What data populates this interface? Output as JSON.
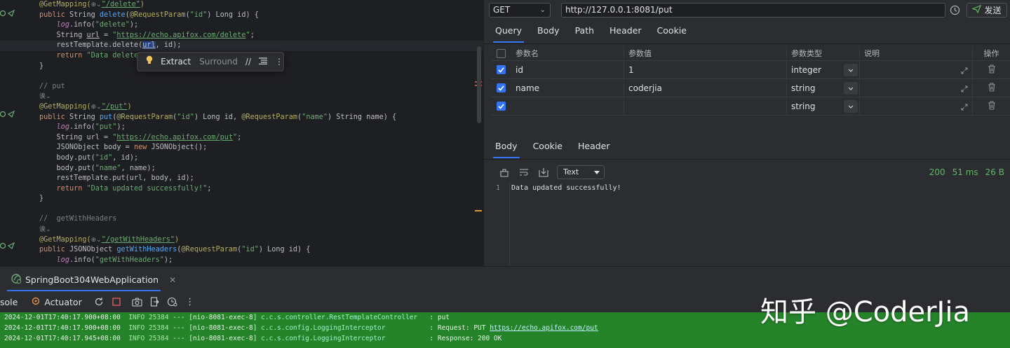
{
  "editor": {
    "code_lines": [
      {
        "segments": [
          {
            "t": "@GetMapping(",
            "c": "an"
          },
          {
            "t": "⊕⌄",
            "c": "hint"
          },
          {
            "t": "\"/delete\"",
            "c": "st ul"
          },
          {
            "t": ")",
            "c": "an"
          }
        ]
      },
      {
        "segments": [
          {
            "t": "public ",
            "c": "kw"
          },
          {
            "t": "String "
          },
          {
            "t": "delete",
            "c": "method"
          },
          {
            "t": "("
          },
          {
            "t": "@RequestParam",
            "c": "an"
          },
          {
            "t": "("
          },
          {
            "t": "\"id\"",
            "c": "st"
          },
          {
            "t": ") Long id) {"
          }
        ]
      },
      {
        "segments": [
          {
            "t": "    "
          },
          {
            "t": "log",
            "c": "lg"
          },
          {
            "t": ".info("
          },
          {
            "t": "\"delete\"",
            "c": "st"
          },
          {
            "t": ");"
          }
        ]
      },
      {
        "segments": [
          {
            "t": "    String "
          },
          {
            "t": "url",
            "c": "ul"
          },
          {
            "t": " = "
          },
          {
            "t": "\"",
            "c": "st"
          },
          {
            "t": "https://echo.apifox.com/delete",
            "c": "st ul"
          },
          {
            "t": "\"",
            "c": "st"
          },
          {
            "t": ";"
          }
        ]
      },
      {
        "current": true,
        "segments": [
          {
            "t": "    restTemplate.delete("
          },
          {
            "t": "url",
            "c": "sel ul"
          },
          {
            "t": ", id);"
          }
        ]
      },
      {
        "segments": [
          {
            "t": "    "
          },
          {
            "t": "return ",
            "c": "kw"
          },
          {
            "t": "\"Data deleted",
            "c": "st"
          }
        ]
      },
      {
        "segments": [
          {
            "t": "}"
          }
        ]
      },
      {
        "segments": [
          {
            "t": ""
          }
        ]
      },
      {
        "segments": [
          {
            "t": "// put",
            "c": "cm"
          }
        ]
      },
      {
        "segments": [
          {
            "t": "诶⌄",
            "c": "hint"
          }
        ]
      },
      {
        "segments": [
          {
            "t": "@GetMapping(",
            "c": "an"
          },
          {
            "t": "⊕⌄",
            "c": "hint"
          },
          {
            "t": "\"/put\"",
            "c": "st ul"
          },
          {
            "t": ")",
            "c": "an"
          }
        ]
      },
      {
        "segments": [
          {
            "t": "public ",
            "c": "kw"
          },
          {
            "t": "String "
          },
          {
            "t": "put",
            "c": "method"
          },
          {
            "t": "("
          },
          {
            "t": "@RequestParam",
            "c": "an"
          },
          {
            "t": "("
          },
          {
            "t": "\"id\"",
            "c": "st"
          },
          {
            "t": ") Long id, "
          },
          {
            "t": "@RequestParam",
            "c": "an"
          },
          {
            "t": "("
          },
          {
            "t": "\"name\"",
            "c": "st"
          },
          {
            "t": ") String name) {"
          }
        ]
      },
      {
        "segments": [
          {
            "t": "    "
          },
          {
            "t": "log",
            "c": "lg"
          },
          {
            "t": ".info("
          },
          {
            "t": "\"put\"",
            "c": "st"
          },
          {
            "t": ");"
          }
        ]
      },
      {
        "segments": [
          {
            "t": "    String url = "
          },
          {
            "t": "\"",
            "c": "st"
          },
          {
            "t": "https://echo.apifox.com/put",
            "c": "st ul"
          },
          {
            "t": "\"",
            "c": "st"
          },
          {
            "t": ";"
          }
        ]
      },
      {
        "segments": [
          {
            "t": "    JSONObject body = "
          },
          {
            "t": "new ",
            "c": "kw"
          },
          {
            "t": "JSONObject();"
          }
        ]
      },
      {
        "segments": [
          {
            "t": "    body.put("
          },
          {
            "t": "\"id\"",
            "c": "st"
          },
          {
            "t": ", id);"
          }
        ]
      },
      {
        "segments": [
          {
            "t": "    body.put("
          },
          {
            "t": "\"name\"",
            "c": "st"
          },
          {
            "t": ", name);"
          }
        ]
      },
      {
        "segments": [
          {
            "t": "    restTemplate.put(url, body, id);"
          }
        ]
      },
      {
        "segments": [
          {
            "t": "    "
          },
          {
            "t": "return ",
            "c": "kw"
          },
          {
            "t": "\"Data updated successfully!\"",
            "c": "st"
          },
          {
            "t": ";"
          }
        ]
      },
      {
        "segments": [
          {
            "t": "}"
          }
        ]
      },
      {
        "segments": [
          {
            "t": ""
          }
        ]
      },
      {
        "segments": [
          {
            "t": "//  getWithHeaders",
            "c": "cm"
          }
        ]
      },
      {
        "segments": [
          {
            "t": "诶⌄",
            "c": "hint"
          }
        ]
      },
      {
        "segments": [
          {
            "t": "@GetMapping(",
            "c": "an"
          },
          {
            "t": "⊕⌄",
            "c": "hint"
          },
          {
            "t": "\"/getWithHeaders\"",
            "c": "st ul"
          },
          {
            "t": ")",
            "c": "an"
          }
        ]
      },
      {
        "segments": [
          {
            "t": "public ",
            "c": "kw"
          },
          {
            "t": "JSONObject "
          },
          {
            "t": "getWithHeaders",
            "c": "method"
          },
          {
            "t": "("
          },
          {
            "t": "@RequestParam",
            "c": "an"
          },
          {
            "t": "("
          },
          {
            "t": "\"id\"",
            "c": "st"
          },
          {
            "t": ") Long id) {"
          }
        ]
      },
      {
        "segments": [
          {
            "t": "    "
          },
          {
            "t": "log",
            "c": "lg"
          },
          {
            "t": ".info("
          },
          {
            "t": "\"getWithHeaders\"",
            "c": "st"
          },
          {
            "t": ");"
          }
        ]
      }
    ],
    "intention_popup": {
      "extract_label": "Extract",
      "surround_label": "Surround"
    }
  },
  "api": {
    "method": "GET",
    "url": "http://127.0.0.1:8081/put",
    "send_label": "发送",
    "request_tabs": [
      "Query",
      "Body",
      "Path",
      "Header",
      "Cookie"
    ],
    "active_request_tab": "Query",
    "param_headers": {
      "name": "参数名",
      "value": "参数值",
      "type": "参数类型",
      "desc": "说明",
      "ops": "操作"
    },
    "params": [
      {
        "checked": true,
        "name": "id",
        "value": "1",
        "type": "integer",
        "desc": ""
      },
      {
        "checked": true,
        "name": "name",
        "value": "coderjia",
        "type": "string",
        "desc": ""
      },
      {
        "checked": true,
        "name": "",
        "value": "",
        "type": "string",
        "desc": ""
      }
    ],
    "response_tabs": [
      "Body",
      "Cookie",
      "Header"
    ],
    "active_response_tab": "Body",
    "format": "Text",
    "status": "200",
    "time": "51 ms",
    "size": "26 B",
    "response_line_no": "1",
    "response_text": "Data updated successfully!"
  },
  "run": {
    "app_tab": "SpringBoot304WebApplication",
    "console_tab": "sole",
    "actuator_tab": "Actuator",
    "log_lines": [
      {
        "ts": "2024-12-01T17:40:17.900+08:00",
        "lvl": "INFO",
        "pid": "25384",
        "sep": "---",
        "thread": "[nio-8081-exec-8]",
        "logger": "c.c.s.controller.RestTemplateController  ",
        "msg": ": put",
        "link": ""
      },
      {
        "ts": "2024-12-01T17:40:17.900+08:00",
        "lvl": "INFO",
        "pid": "25384",
        "sep": "---",
        "thread": "[nio-8081-exec-8]",
        "logger": "c.c.s.config.LoggingInterceptor          ",
        "msg": ": Request: PUT ",
        "link": "https://echo.apifox.com/put"
      },
      {
        "ts": "2024-12-01T17:40:17.945+08:00",
        "lvl": "INFO",
        "pid": "25384",
        "sep": "---",
        "thread": "[nio-8081-exec-8]",
        "logger": "c.c.s.config.LoggingInterceptor          ",
        "msg": ": Response: 200 OK",
        "link": ""
      }
    ]
  },
  "watermark": "知乎 @CoderJia",
  "colors": {
    "accent": "#3574f0",
    "status_ok": "#5fb865",
    "console_highlight": "#258429",
    "editor_bg": "#1e1f22",
    "panel_bg": "#2b2d30"
  },
  "icons": [
    "bulb-icon",
    "comment-icon",
    "reformat-icon",
    "more-vert-icon",
    "history-icon",
    "send-icon",
    "checkbox-icon",
    "chevron-down-icon",
    "expand-icon",
    "trash-icon",
    "clear-icon",
    "wrap-icon",
    "download-icon",
    "spring-icon",
    "close-icon",
    "actuator-icon",
    "rerun-icon",
    "stop-icon",
    "camera-icon",
    "exit-icon",
    "dump-icon"
  ]
}
